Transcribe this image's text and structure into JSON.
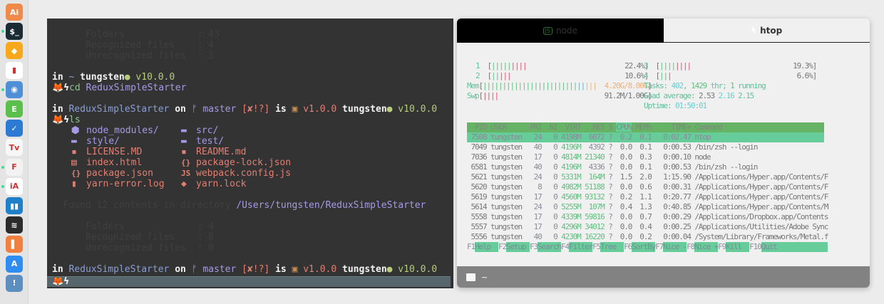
{
  "dock": {
    "items": [
      {
        "name": "illustrator",
        "label": "Ai",
        "color": "#f08a4b",
        "running": false
      },
      {
        "name": "iterm",
        "label": "$_",
        "color": "#1b2a33",
        "running": true
      },
      {
        "name": "sketch",
        "label": "◆",
        "color": "#f7a81b",
        "running": false
      },
      {
        "name": "scrivener",
        "label": "▮",
        "color": "#ffffff",
        "running": false
      },
      {
        "name": "tweetbot",
        "label": "◉",
        "color": "#4f8fd6",
        "running": true
      },
      {
        "name": "evernote",
        "label": "E",
        "color": "#5bbf4b",
        "running": false
      },
      {
        "name": "things",
        "label": "✓",
        "color": "#2c7ad4",
        "running": false
      },
      {
        "name": "tv-forecast",
        "label": "Tv",
        "color": "#f7f7f7",
        "running": false
      },
      {
        "name": "font-app",
        "label": "F",
        "color": "#f2f2f2",
        "running": true
      },
      {
        "name": "ia-writer",
        "label": "iA",
        "color": "#ffffff",
        "running": true
      },
      {
        "name": "trello",
        "label": "▮▮",
        "color": "#1f7fc9",
        "running": false
      },
      {
        "name": "spotify",
        "label": "≋",
        "color": "#2b2b2b",
        "running": false
      },
      {
        "name": "notebook",
        "label": "▌",
        "color": "#f08040",
        "running": false
      },
      {
        "name": "app-store",
        "label": "A",
        "color": "#2f8cf0",
        "running": false
      },
      {
        "name": "1password",
        "label": "!",
        "color": "#5c8fbf",
        "running": false
      }
    ]
  },
  "terminal": {
    "lines": [
      {
        "i": 0,
        "seg": [
          [
            "      Folders             : 43",
            "dim"
          ]
        ]
      },
      {
        "i": 1,
        "seg": [
          [
            "      Recognized files    : 4",
            "dim"
          ]
        ]
      },
      {
        "i": 2,
        "seg": [
          [
            "      Unrecognized files  : 3",
            "dim"
          ]
        ]
      },
      {
        "i": 4,
        "seg": [
          [
            "in ",
            "white"
          ],
          [
            "~ ",
            "blue"
          ],
          [
            "tungsten",
            "white"
          ],
          [
            "●",
            "green"
          ],
          [
            " v10.0.0",
            "green"
          ]
        ]
      },
      {
        "i": 5,
        "seg": [
          [
            "🦊ϟ",
            "white"
          ],
          [
            "cd ",
            "cmd"
          ],
          [
            "ReduxSimpleStarter",
            "purple"
          ]
        ]
      },
      {
        "i": 7,
        "seg": [
          [
            "in ",
            "white"
          ],
          [
            "ReduxSimpleStarter",
            "blue"
          ],
          [
            " on ",
            "white"
          ],
          [
            "ᚠ ",
            "purple"
          ],
          [
            "master ",
            "purple"
          ],
          [
            "[✘!?]",
            "salmon"
          ],
          [
            " is ",
            "white"
          ],
          [
            "▣",
            "brown"
          ],
          [
            " v1.0.0 ",
            "salmon"
          ],
          [
            "tungsten",
            "white"
          ],
          [
            "●",
            "green"
          ],
          [
            " v10.0.0",
            "green"
          ]
        ]
      },
      {
        "i": 8,
        "seg": [
          [
            "🦊ϟ",
            "white"
          ],
          [
            "ls",
            "cmd"
          ]
        ]
      },
      {
        "i": 16,
        "seg": [
          [
            "  Found 12 contents in directory ",
            "dim"
          ],
          [
            "/Users/tungsten/ReduxSimpleStarter",
            "purple"
          ]
        ]
      },
      {
        "i": 18,
        "seg": [
          [
            "      Folders             : 4",
            "dim"
          ]
        ]
      },
      {
        "i": 19,
        "seg": [
          [
            "      Recognized files    : 8",
            "dim"
          ]
        ]
      },
      {
        "i": 20,
        "seg": [
          [
            "      Unrecognized files  : 0",
            "dim"
          ]
        ]
      },
      {
        "i": 22,
        "seg": [
          [
            "in ",
            "white"
          ],
          [
            "ReduxSimpleStarter",
            "blue"
          ],
          [
            " on ",
            "white"
          ],
          [
            "ᚠ ",
            "purple"
          ],
          [
            "master ",
            "purple"
          ],
          [
            "[✘!?]",
            "salmon"
          ],
          [
            " is ",
            "white"
          ],
          [
            "▣",
            "brown"
          ],
          [
            " v1.0.0 ",
            "salmon"
          ],
          [
            "tungsten",
            "white"
          ],
          [
            "●",
            "green"
          ],
          [
            " v10.0.0",
            "green"
          ]
        ]
      }
    ],
    "ls": [
      {
        "icon": "⬢",
        "name": "node_modules/",
        "color": "purple"
      },
      {
        "icon": "▬",
        "name": "src/",
        "color": "purple"
      },
      {
        "icon": "▬",
        "name": "style/",
        "color": "purple"
      },
      {
        "icon": "▬",
        "name": "test/",
        "color": "purple"
      },
      {
        "icon": "▪",
        "name": "LICENSE.MD",
        "color": "salmon"
      },
      {
        "icon": "▪",
        "name": "README.md",
        "color": "salmon"
      },
      {
        "icon": "▤",
        "name": "index.html",
        "color": "salmon"
      },
      {
        "icon": "{}",
        "name": "package-lock.json",
        "color": "salmon"
      },
      {
        "icon": "{}",
        "name": "package.json",
        "color": "salmon"
      },
      {
        "icon": "JS",
        "name": "webpack.config.js",
        "color": "salmon"
      },
      {
        "icon": "▮",
        "name": "yarn-error.log",
        "color": "salmon"
      },
      {
        "icon": "◆",
        "name": "yarn.lock",
        "color": "salmon"
      }
    ],
    "prompt_symbol": "🦊ϟ",
    "input_value": ""
  },
  "htop_window": {
    "tabs": [
      {
        "label": "node",
        "icon": "nodejs-icon",
        "active": false
      },
      {
        "label": "htop",
        "icon": "lightning-icon",
        "active": true
      }
    ],
    "meters": {
      "cpus": [
        {
          "label": "1",
          "green": 5,
          "red": 4,
          "value": "22.4%"
        },
        {
          "label": "2",
          "green": 2,
          "red": 3,
          "value": "10.6%"
        },
        {
          "label": "3",
          "green": 4,
          "red": 4,
          "value": "19.3%"
        },
        {
          "label": "4",
          "green": 2,
          "red": 1,
          "value": "6.6%"
        }
      ],
      "mem": {
        "label": "Mem",
        "green": 24,
        "blue": 2,
        "orange": 3,
        "value": "4.20G/8.00G"
      },
      "swp": {
        "label": "Swp",
        "red": 4,
        "value": "91.2M/1.00G"
      },
      "tasks": {
        "label": "Tasks: ",
        "count": "402",
        "thr": "1429",
        "running": "1"
      },
      "load": {
        "label": "Load average: ",
        "one": "2.53",
        "five": "2.16",
        "fifteen": "2.15"
      },
      "uptime": {
        "label": "Uptime: ",
        "value": "01:50:01"
      }
    },
    "columns": [
      "PID",
      "USER",
      "PRI",
      "NI",
      "VIRT",
      "RES",
      "S",
      "CPU%",
      "MEM%",
      "TIME+",
      "Command"
    ],
    "sorted_column": "CPU%",
    "processes": [
      [
        "7508",
        "tungsten",
        "24",
        "0",
        "4198M",
        "6072",
        "?",
        "0.2",
        "0.1",
        "0:02.47",
        "htop"
      ],
      [
        "7049",
        "tungsten",
        "40",
        "0",
        "4196M",
        "4392",
        "?",
        "0.0",
        "0.1",
        "0:00.53",
        "/bin/zsh --login"
      ],
      [
        "7036",
        "tungsten",
        "17",
        "0",
        "4814M",
        "21340",
        "?",
        "0.0",
        "0.3",
        "0:00.10",
        "node"
      ],
      [
        "6581",
        "tungsten",
        "40",
        "0",
        "4196M",
        "4336",
        "?",
        "0.0",
        "0.1",
        "0:00.53",
        "/bin/zsh --login"
      ],
      [
        "5621",
        "tungsten",
        "24",
        "0",
        "5331M",
        "164M",
        "?",
        "1.5",
        "2.0",
        "1:15.90",
        "/Applications/Hyper.app/Contents/F"
      ],
      [
        "5620",
        "tungsten",
        "8",
        "0",
        "4982M",
        "51188",
        "?",
        "0.0",
        "0.6",
        "0:00.31",
        "/Applications/Hyper.app/Contents/F"
      ],
      [
        "5619",
        "tungsten",
        "17",
        "0",
        "4560M",
        "93132",
        "?",
        "0.2",
        "1.1",
        "0:20.77",
        "/Applications/Hyper.app/Contents/F"
      ],
      [
        "5614",
        "tungsten",
        "24",
        "0",
        "5255M",
        "107M",
        "?",
        "0.4",
        "1.3",
        "0:40.85",
        "/Applications/Hyper.app/Contents/M"
      ],
      [
        "5558",
        "tungsten",
        "17",
        "0",
        "4339M",
        "59816",
        "?",
        "0.0",
        "0.7",
        "0:00.29",
        "/Applications/Dropbox.app/Contents"
      ],
      [
        "5557",
        "tungsten",
        "17",
        "0",
        "4296M",
        "34012",
        "?",
        "0.0",
        "0.4",
        "0:00.25",
        "/Applications/Utilities/Adobe Sync"
      ],
      [
        "5556",
        "tungsten",
        "40",
        "0",
        "4230M",
        "16220",
        "?",
        "0.0",
        "0.2",
        "0:00.04",
        "/System/Library/Frameworks/Metal.f"
      ]
    ],
    "selected_row": 0,
    "function_keys": [
      {
        "key": "F1",
        "label": "Help"
      },
      {
        "key": "F2",
        "label": "Setup"
      },
      {
        "key": "F3",
        "label": "Search"
      },
      {
        "key": "F4",
        "label": "Filter"
      },
      {
        "key": "F5",
        "label": "Tree"
      },
      {
        "key": "F6",
        "label": "SortBy"
      },
      {
        "key": "F7",
        "label": "Nice -"
      },
      {
        "key": "F8",
        "label": "Nice +"
      },
      {
        "key": "F9",
        "label": "Kill"
      },
      {
        "key": "F10",
        "label": "Quit"
      }
    ],
    "status_path": "~"
  }
}
